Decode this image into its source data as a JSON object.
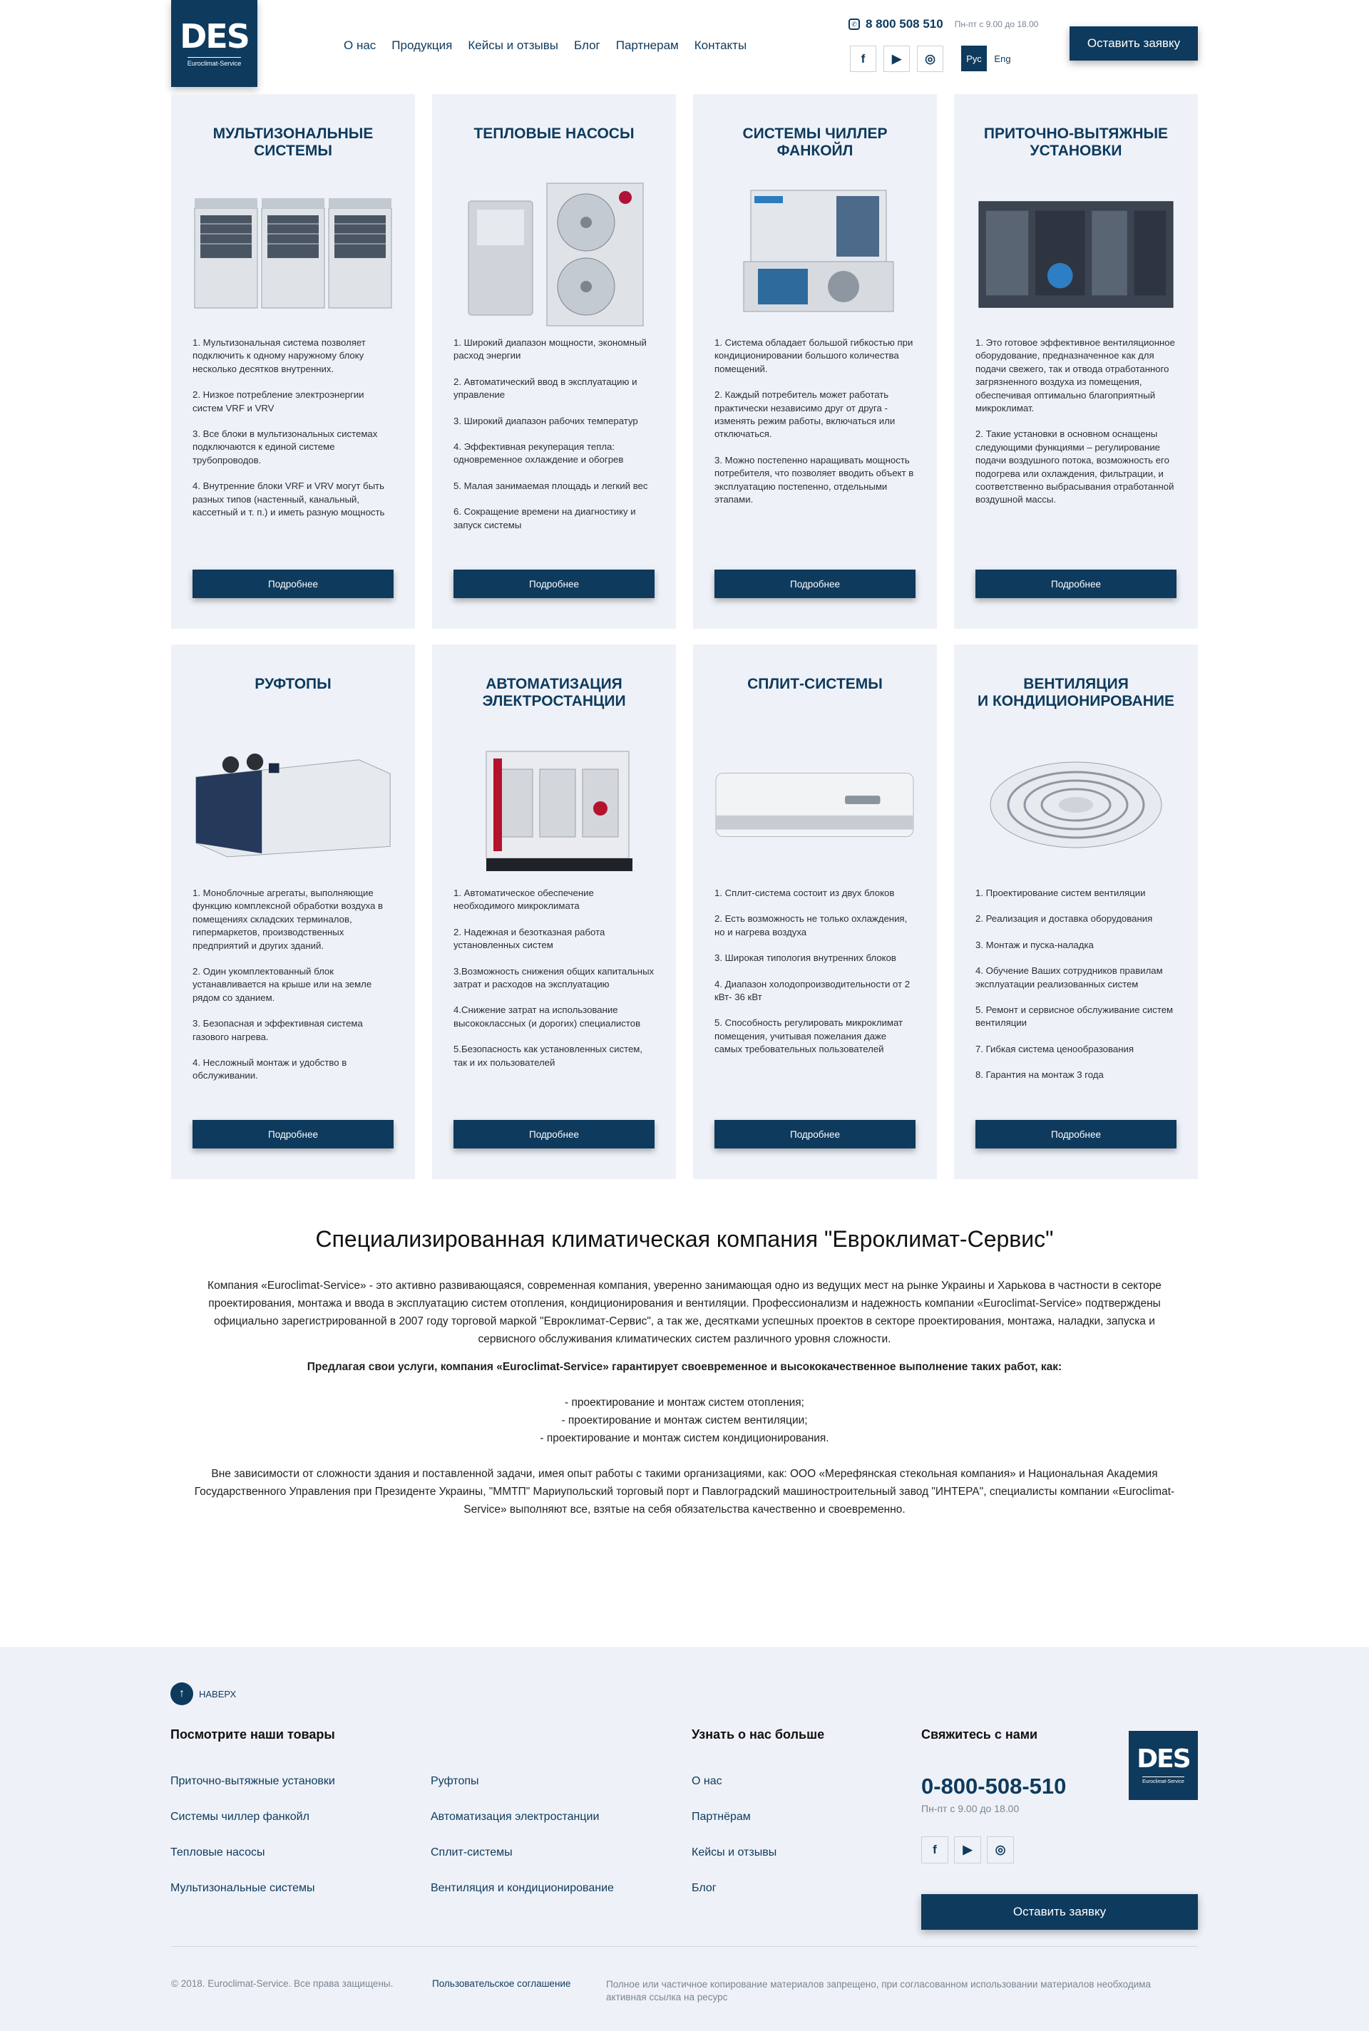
{
  "header": {
    "logo_mark": "DES",
    "logo_sub": "Euroclimat-Service",
    "nav": [
      "О нас",
      "Продукция",
      "Кейсы и отзывы",
      "Блог",
      "Партнерам",
      "Контакты"
    ],
    "phone": "8 800 508 510",
    "hours": "Пн-пт с 9.00 до 18.00",
    "lang_ru": "Рус",
    "lang_en": "Eng",
    "order_button": "Оставить заявку"
  },
  "products": [
    {
      "title": "Мультизональные\nсистемы",
      "items": [
        "1. Мультизональная система позволяет подключить к одному наружному блоку несколько десятков внутренних.",
        "2. Низкое потребление электроэнергии систем VRF и VRV",
        "3. Все блоки в мультизональных системах подключаются к единой системе трубопроводов.",
        "4. Внутренние блоки VRF и VRV могут быть разных типов (настенный, канальный, кассетный и т. п.) и иметь разную мощность"
      ],
      "button": "Подробнее"
    },
    {
      "title": "Тепловые насосы",
      "items": [
        "1. Широкий диапазон мощности, экономный расход энергии",
        "2. Автоматический ввод в эксплуатацию и управление",
        "3. Широкий диапазон рабочих температур",
        "4. Эффективная рекуперация тепла: одновременное охлаждение и обогрев",
        "5. Малая занимаемая площадь и легкий вес",
        "6. Сокращение времени на диагностику и запуск системы"
      ],
      "button": "Подробнее"
    },
    {
      "title": "Системы чиллер\nфанкойл",
      "items": [
        "1. Система обладает большой гибкостью при кондиционировании большого количества помещений.",
        "2. Каждый потребитель может работать практически независимо друг от друга - изменять режим работы, включаться или отключаться.",
        "3. Можно постепенно наращивать мощность потребителя, что позволяет вводить объект в эксплуатацию постепенно, отдельными этапами."
      ],
      "button": "Подробнее"
    },
    {
      "title": "Приточно-вытяжные\nустановки",
      "items": [
        "1. Это готовое эффективное вентиляционное оборудование, предназначенное как для подачи свежего, так и отвода отработанного загрязненного воздуха из помещения, обеспечивая оптимально благоприятный микроклимат.",
        "2. Такие установки в основном оснащены следующими функциями – регулирование подачи воздушного потока, возможность его подогрева или охлаждения, фильтрации, и соответственно выбрасывания отработанной воздушной массы."
      ],
      "button": "Подробнее"
    },
    {
      "title": "Руфтопы",
      "items": [
        "1. Моноблочные агрегаты, выполняющие функцию комплексной обработки воздуха в помещениях складских терминалов, гипермаркетов, производственных предприятий и других зданий.",
        "2. Один укомплектованный блок устанавливается на крыше или на земле рядом со зданием.",
        "3. Безопасная и эффективная система газового нагрева.",
        "4. Несложный монтаж и удобство в обслуживании."
      ],
      "button": "Подробнее"
    },
    {
      "title": "Автоматизация\nэлектростанции",
      "items": [
        "1. Автоматическое обеспечение необходимого микроклимата",
        "2. Надежная и безотказная работа установленных систем",
        "3.Возможность снижения общих капитальных затрат и расходов на эксплуатацию",
        "4.Снижение затрат на использование высококлассных (и дорогих) специалистов",
        "5.Безопасность как установленных систем, так и их пользователей"
      ],
      "button": "Подробнее"
    },
    {
      "title": "Сплит-системы",
      "items": [
        "1. Сплит-система состоит из двух блоков",
        "2. Есть возможность не только охлаждения, но и нагрева воздуха",
        "3. Широкая типология внутренних блоков",
        "4. Диапазон холодопроизводительности от  2 кВт- 36 кВт",
        "5. Способность регулировать микроклимат помещения, учитывая пожелания даже самых требовательных пользователей"
      ],
      "button": "Подробнее"
    },
    {
      "title": "Вентиляция\nи кондиционирование",
      "items": [
        "1. Проектирование систем вентиляции",
        "2. Реализация и доставка оборудования",
        "3. Монтаж и пуска-наладка",
        "4. Обучение Ваших сотрудников правилам эксплуатации реализованных систем",
        "5. Ремонт и сервисное обслуживание систем вентиляции",
        "7. Гибкая система ценообразования",
        "8. Гарантия на монтаж 3 года"
      ],
      "button": "Подробнее"
    }
  ],
  "about": {
    "title": "Специализированная климатическая компания \"Евроклимат-Сервис\"",
    "intro": "Компания «Euroclimat-Service» - это активно развивающаяся, современная компания, уверенно занимающая одно из ведущих мест на рынке Украины и Харькова в частности в секторе проектирования, монтажа и ввода в эксплуатацию систем отопления, кондиционирования и вентиляции. Профессионализм и надежность компании «Euroclimat-Service» подтверждены официально зарегистрированной в 2007 году торговой маркой \"Евроклимат-Сервис\", а так же, десятками успешных проектов в секторе проектирования, монтажа, наладки, запуска и сервисного обслуживания климатических систем различного уровня сложности.",
    "lead": "Предлагая свои услуги, компания «Euroclimat-Service» гарантирует своевременное и высококачественное выполнение таких работ, как:",
    "list": [
      "- проектирование и монтаж систем отопления;",
      "- проектирование и монтаж систем вентиляции;",
      "- проектирование и монтаж систем кондиционирования."
    ],
    "closing": "Вне зависимости от сложности здания и поставленной задачи, имея опыт работы с такими организациями, как: ООО «Мерефянская стекольная компания» и Национальная Академия Государственного Управления при Президенте Украины, \"ММТП\" Мариупольский торговый порт и Павлоградский машиностроительный завод \"ИНТЕРА\", специалисты компании «Euroclimat-Service» выполняют все, взятые на себя обязательства качественно и своевременно."
  },
  "footer": {
    "to_top": "НАВЕРХ",
    "products_heading": "Посмотрите наши товары",
    "products_col1": [
      "Приточно-вытяжные установки",
      "Системы чиллер фанкойл",
      "Тепловые насосы",
      "Мультизональные системы"
    ],
    "products_col2": [
      "Руфтопы",
      "Автоматизация электростанции",
      "Сплит-системы",
      "Вентиляция и кондиционирование"
    ],
    "about_heading": "Узнать о нас больше",
    "about_links": [
      "О нас",
      "Партнёрам",
      "Кейсы и отзывы",
      "Блог"
    ],
    "contact_heading": "Свяжитесь с нами",
    "phone": "0-800-508-510",
    "hours": "Пн-пт с 9.00 до 18.00",
    "order_button": "Оставить заявку",
    "copyright": "© 2018. Euroclimat-Service. Все права защищены.",
    "agreement": "Пользовательское соглашение",
    "note": "Полное или частичное копирование материалов запрещено, при согласованном использовании материалов необходима активная ссылка на ресурс"
  },
  "colors": {
    "brand": "#0e3a5d",
    "card_bg": "#eef2f8"
  }
}
